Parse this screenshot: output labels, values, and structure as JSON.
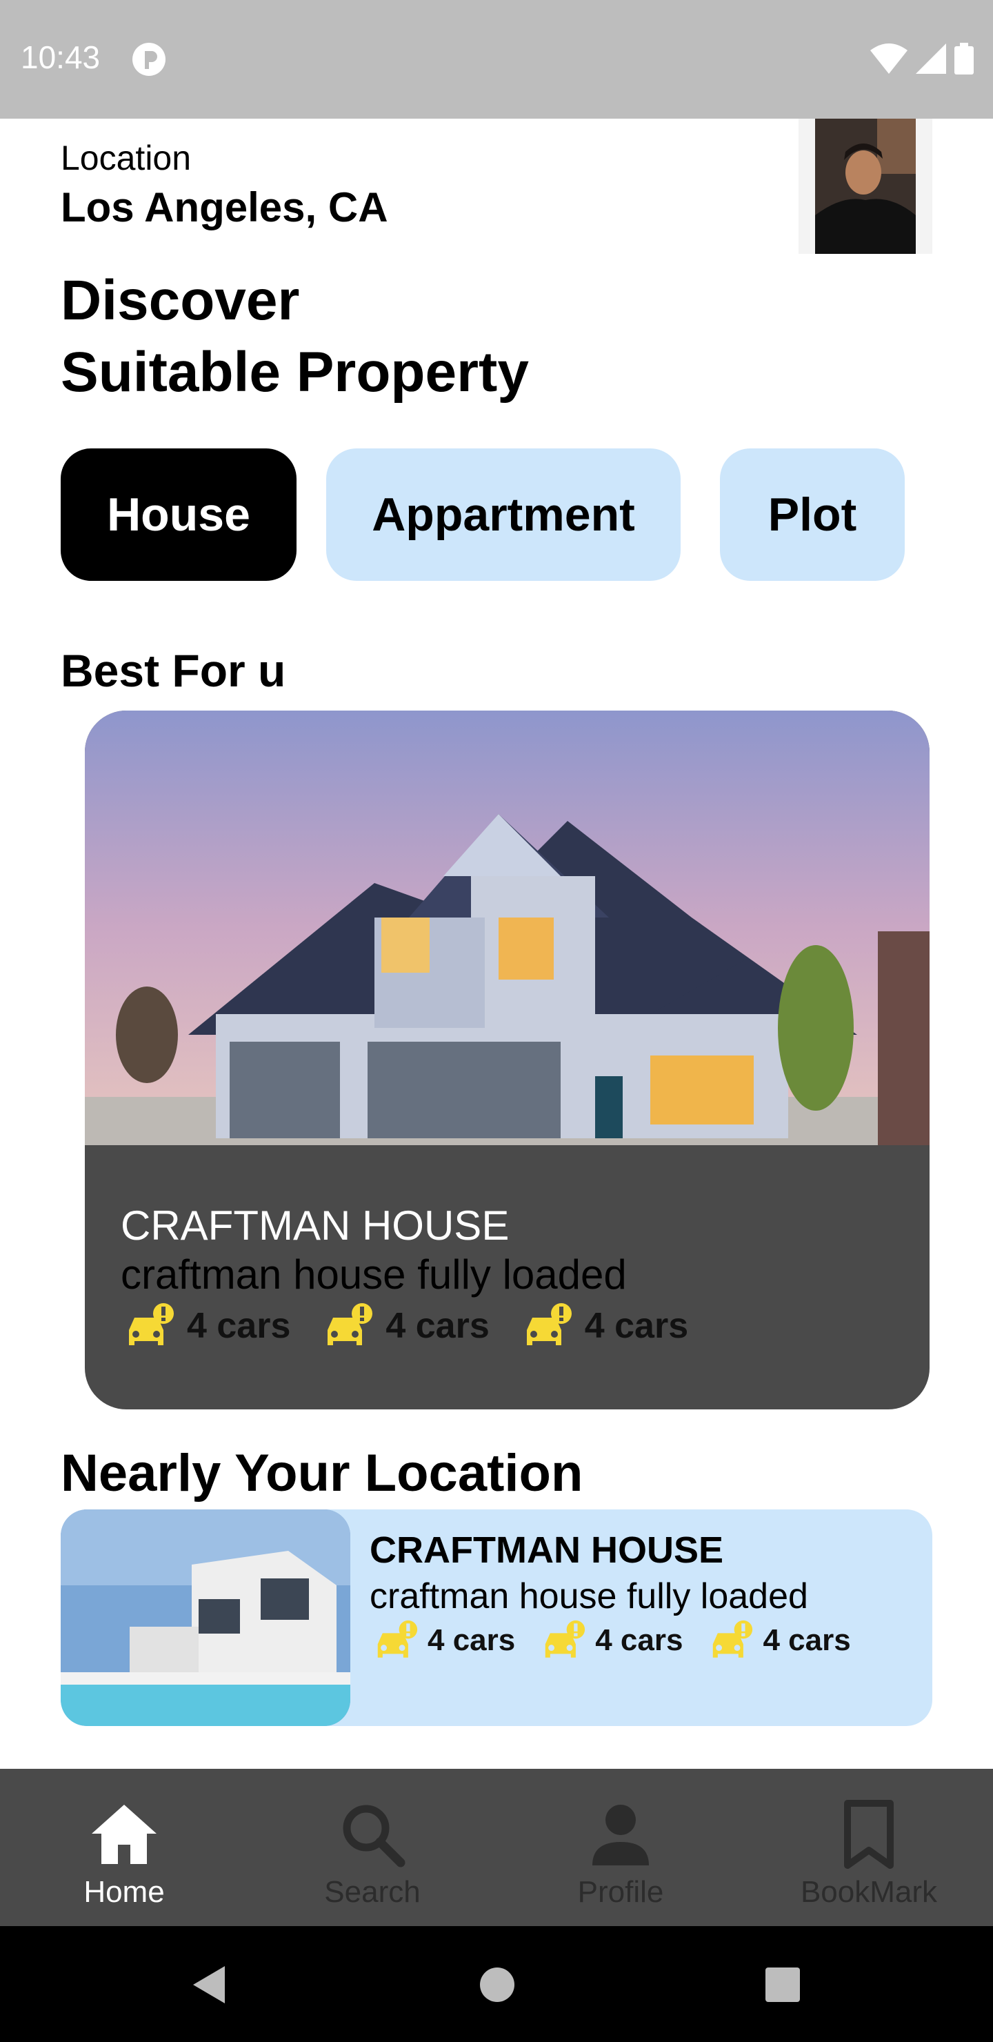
{
  "status": {
    "time": "10:43"
  },
  "header": {
    "location_label": "Location",
    "location_value": "Los Angeles, CA"
  },
  "headline": {
    "line1": "Discover",
    "line2": "Suitable Property"
  },
  "categories": [
    {
      "label": "House",
      "selected": true
    },
    {
      "label": "Appartment",
      "selected": false
    },
    {
      "label": "Plot",
      "selected": false
    }
  ],
  "best": {
    "section_title": "Best For u",
    "card": {
      "title": "CRAFTMAN HOUSE",
      "subtitle": "craftman house fully loaded",
      "amenities": [
        "4 cars",
        "4 cars",
        "4 cars"
      ]
    }
  },
  "nearby": {
    "section_title": "Nearly Your Location",
    "card": {
      "title": "CRAFTMAN HOUSE",
      "subtitle": "craftman house fully loaded",
      "amenities": [
        "4 cars",
        "4 cars",
        "4 cars"
      ]
    }
  },
  "nav": [
    {
      "label": "Home",
      "icon": "home-icon",
      "active": true
    },
    {
      "label": "Search",
      "icon": "search-icon",
      "active": false
    },
    {
      "label": "Profile",
      "icon": "person-icon",
      "active": false
    },
    {
      "label": "BookMark",
      "icon": "bookmark-icon",
      "active": false
    }
  ],
  "colors": {
    "chip_selected": "#000000",
    "chip_idle": "#cde6fb",
    "card_dark": "#4a4a4a",
    "amenity_icon": "#f6d935",
    "nav_bg": "#4a4a4a"
  }
}
